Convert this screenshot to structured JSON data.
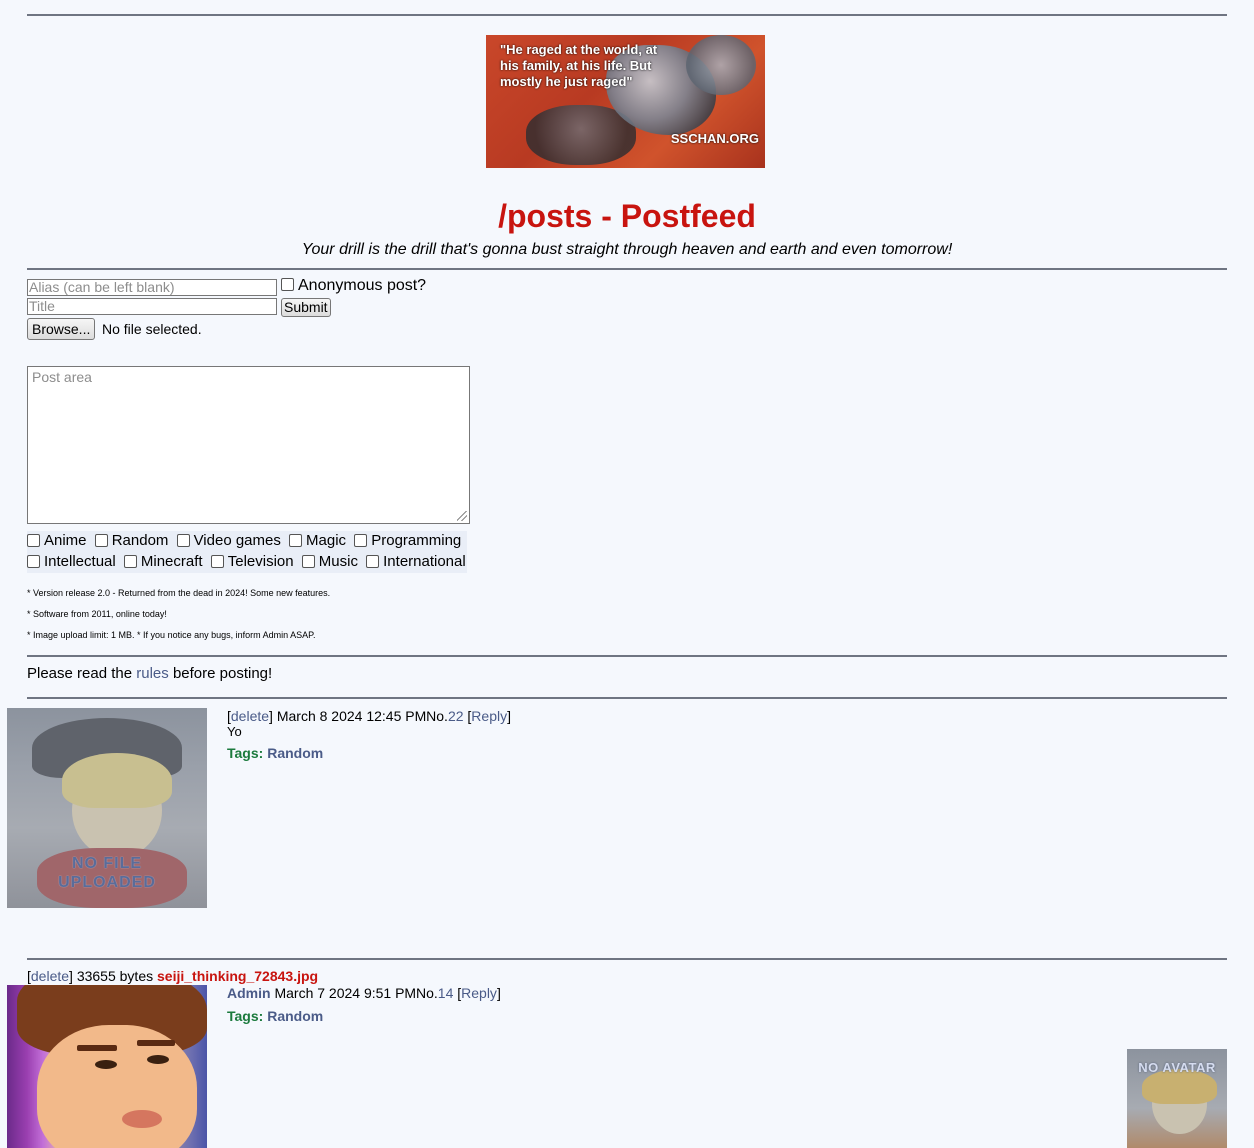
{
  "banner": {
    "quote": "\"He raged at the world, at his family, at his life. But mostly he just raged\"",
    "site": "SSCHAN.ORG"
  },
  "board": {
    "title": "/posts - Postfeed",
    "subtitle": "Your drill is the drill that's gonna bust straight through heaven and earth and even tomorrow!"
  },
  "form": {
    "alias_placeholder": "Alias (can be left blank)",
    "title_placeholder": "Title",
    "anonymous_label": "Anonymous post?",
    "submit_label": "Submit",
    "browse_label": "Browse...",
    "file_status": "No file selected.",
    "post_placeholder": "Post area",
    "tags_row1": [
      "Anime",
      "Random",
      "Video games",
      "Magic",
      "Programming"
    ],
    "tags_row2": [
      "Intellectual",
      "Minecraft",
      "Television",
      "Music",
      "International"
    ]
  },
  "notes": [
    "* Version release 2.0 - Returned from the dead in 2024! Some new features.",
    "* Software from 2011, online today!",
    "* Image upload limit: 1 MB. * If you notice any bugs, inform Admin ASAP."
  ],
  "rules": {
    "before": "Please read the",
    "link": "rules",
    "after": "before posting!"
  },
  "posts": [
    {
      "thumb_label_1": "NO FILE",
      "thumb_label_2": "UPLOADED",
      "delete": "delete",
      "date": "March 8 2024 12:45 PM",
      "no_prefix": "No.",
      "number": "22",
      "reply": "Reply",
      "body": "Yo",
      "tags_label": "Tags:",
      "tags": "Random"
    },
    {
      "delete": "delete",
      "filesize": "33655 bytes",
      "filename": "seiji_thinking_72843.jpg",
      "author": "Admin",
      "date": "March 7 2024 9:51 PM",
      "no_prefix": "No.",
      "number": "14",
      "reply": "Reply",
      "tags_label": "Tags:",
      "tags": "Random",
      "avatar_label": "NO AVATAR"
    }
  ]
}
